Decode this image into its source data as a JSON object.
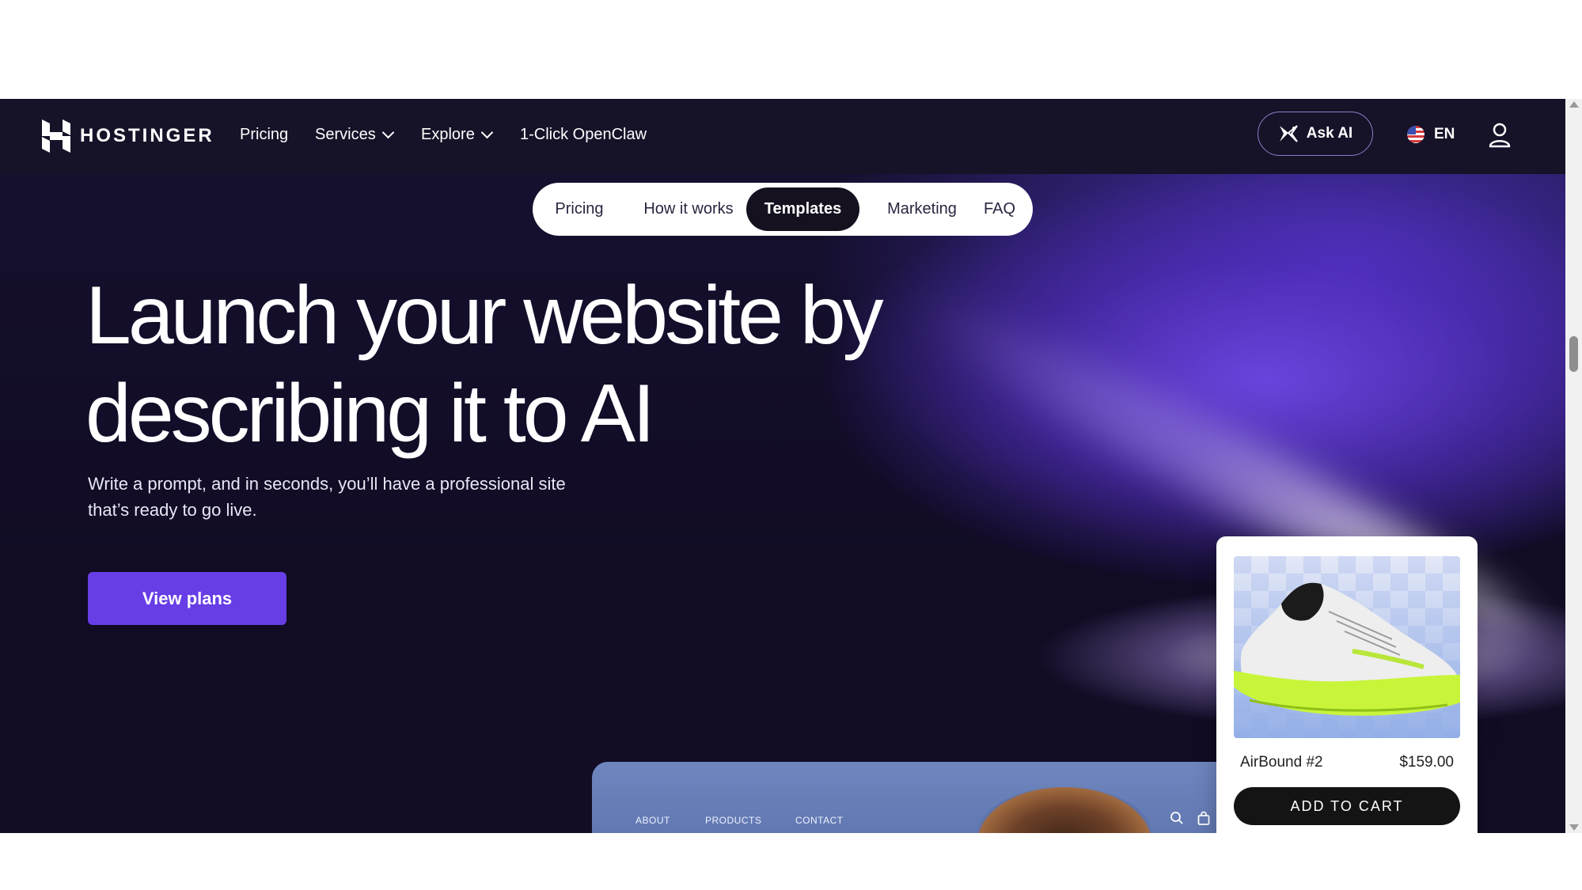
{
  "header": {
    "brand": "HOSTINGER",
    "nav": [
      {
        "label": "Pricing",
        "has_dropdown": false
      },
      {
        "label": "Services",
        "has_dropdown": true
      },
      {
        "label": "Explore",
        "has_dropdown": true
      },
      {
        "label": "1-Click OpenClaw",
        "has_dropdown": false
      }
    ],
    "ask_ai_label": "Ask AI",
    "language": "EN",
    "icons": {
      "logo": "hostinger-logo",
      "ask_ai": "sparkle-icon",
      "flag": "us-flag-icon",
      "user": "user-icon"
    }
  },
  "section_tabs": {
    "items": [
      "Pricing",
      "How it works",
      "Templates",
      "Marketing",
      "FAQ"
    ],
    "active": "Templates"
  },
  "hero": {
    "title_line1": "Launch your website by",
    "title_line2": "describing it to AI",
    "subtitle_line1": "Write a prompt, and in seconds, you’ll have a professional site",
    "subtitle_line2": "that’s ready to go live.",
    "cta_label": "View plans"
  },
  "preview_site": {
    "nav": [
      "ABOUT",
      "PRODUCTS",
      "CONTACT"
    ],
    "icons": [
      "search-icon",
      "shopping-bag-icon"
    ]
  },
  "product_card": {
    "name": "AirBound #2",
    "price": "$159.00",
    "button_label": "ADD TO CART"
  },
  "colors": {
    "accent": "#673de6",
    "nav_bg": "#161228",
    "hero_bg": "#120c25"
  }
}
